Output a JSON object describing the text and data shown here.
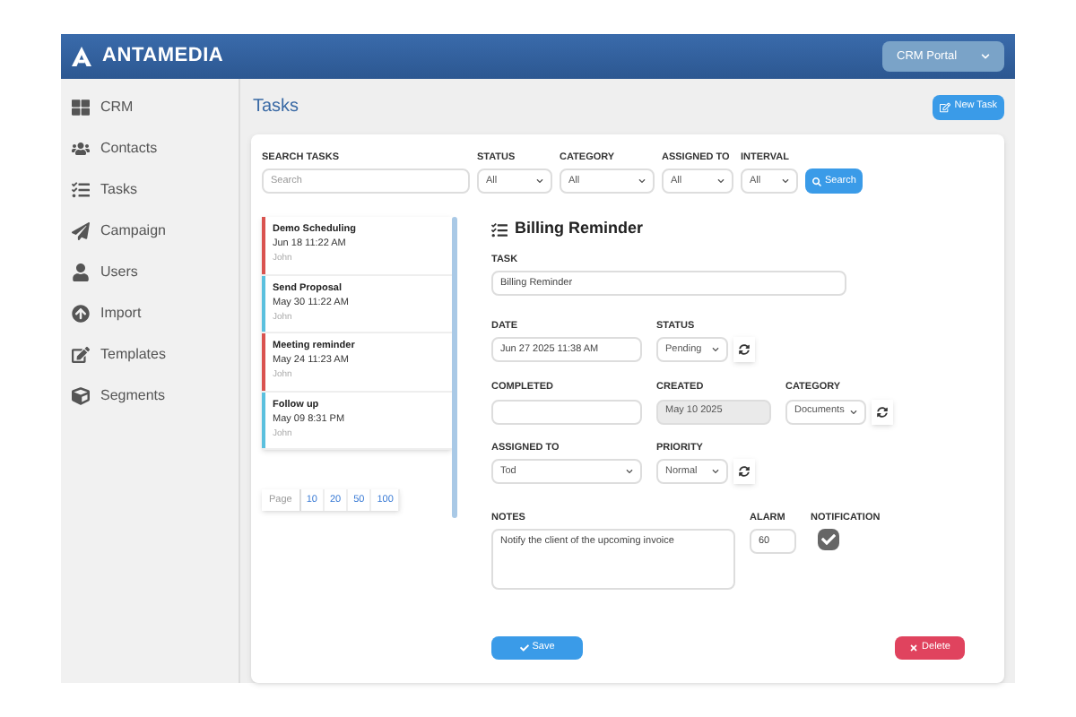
{
  "header": {
    "logo_text": "ANTAMEDIA",
    "portal_select": "CRM Portal"
  },
  "sidebar": {
    "items": [
      {
        "label": "CRM"
      },
      {
        "label": "Contacts"
      },
      {
        "label": "Tasks"
      },
      {
        "label": "Campaign"
      },
      {
        "label": "Users"
      },
      {
        "label": "Import"
      },
      {
        "label": "Templates"
      },
      {
        "label": "Segments"
      }
    ]
  },
  "page_title": "Tasks",
  "new_task_button": "New Task",
  "filters": [
    {
      "label": "SEARCH TASKS",
      "kind": "text",
      "placeholder": "Search"
    },
    {
      "label": "STATUS",
      "kind": "select",
      "value": "All"
    },
    {
      "label": "CATEGORY",
      "kind": "select",
      "value": "All"
    },
    {
      "label": "ASSIGNED TO",
      "kind": "select",
      "value": "All"
    },
    {
      "label": "INTERVAL",
      "kind": "select",
      "value": "All"
    }
  ],
  "search_button": "Search",
  "tasks": [
    {
      "title": "Demo Scheduling",
      "date": "Jun 18 11:22 AM",
      "owner": "John",
      "color": "#d9534f"
    },
    {
      "title": "Send Proposal",
      "date": "May 30 11:22 AM",
      "owner": "John",
      "color": "#5bc0de"
    },
    {
      "title": "Meeting reminder",
      "date": "May 24 11:23 AM",
      "owner": "John",
      "color": "#d9534f"
    },
    {
      "title": "Follow up",
      "date": "May 09 8:31 PM",
      "owner": "John",
      "color": "#5bc0de"
    }
  ],
  "pagination": {
    "label": "Page",
    "sizes": [
      "10",
      "20",
      "50",
      "100"
    ]
  },
  "detail": {
    "title": "Billing Reminder",
    "rows": [
      [
        {
          "label": "TASK",
          "kind": "text",
          "value": "Billing Reminder"
        }
      ],
      [
        {
          "label": "DATE",
          "kind": "text",
          "value": "Jun 27 2025 11:38 AM"
        },
        {
          "label": "STATUS",
          "kind": "select",
          "value": "Pending",
          "refresh": true
        }
      ],
      [
        {
          "label": "COMPLETED",
          "kind": "text"
        },
        {
          "label": "CREATED",
          "kind": "readonly",
          "value": "May 10 2025"
        },
        {
          "label": "CATEGORY",
          "kind": "select",
          "value": "Documents",
          "refresh": true
        }
      ],
      [
        {
          "label": "ASSIGNED TO",
          "kind": "select",
          "value": "Tod"
        },
        {
          "label": "PRIORITY",
          "kind": "select",
          "value": "Normal",
          "refresh": true
        }
      ],
      [
        {
          "label": "NOTES",
          "kind": "textarea",
          "value": "Notify the client of the upcoming invoice"
        },
        {
          "label": "ALARM",
          "kind": "text",
          "value": "60"
        },
        {
          "label": "NOTIFICATION",
          "kind": "checkbox",
          "checked": true
        }
      ]
    ]
  },
  "save_button": "Save",
  "delete_button": "Delete"
}
